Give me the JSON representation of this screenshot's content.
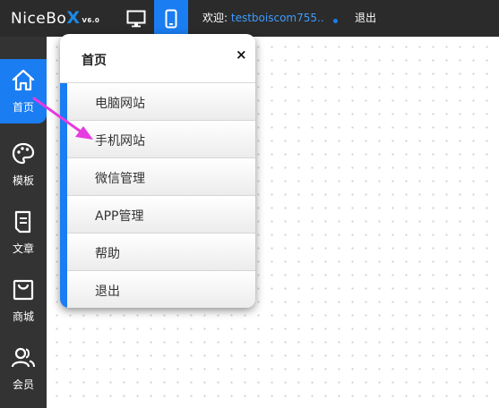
{
  "header": {
    "logo_text": "NiceBo",
    "logo_x": "X",
    "logo_version": "V6.0",
    "welcome_prefix": "欢迎:",
    "username": "testboiscom755..",
    "logout": "退出"
  },
  "sidebar": {
    "items": [
      {
        "label": "首页",
        "icon": "home-icon"
      },
      {
        "label": "模板",
        "icon": "palette-icon"
      },
      {
        "label": "文章",
        "icon": "document-icon"
      },
      {
        "label": "商城",
        "icon": "bag-icon"
      },
      {
        "label": "会员",
        "icon": "members-icon"
      }
    ]
  },
  "menu": {
    "title": "首页",
    "close": "×",
    "items": [
      {
        "label": "电脑网站"
      },
      {
        "label": "手机网站"
      },
      {
        "label": "微信管理"
      },
      {
        "label": "APP管理"
      },
      {
        "label": "帮助"
      },
      {
        "label": "退出"
      }
    ]
  },
  "colors": {
    "accent": "#1a7df2",
    "topbar": "#2b2b2b",
    "sidebar": "#333333",
    "arrow": "#e63be0"
  }
}
